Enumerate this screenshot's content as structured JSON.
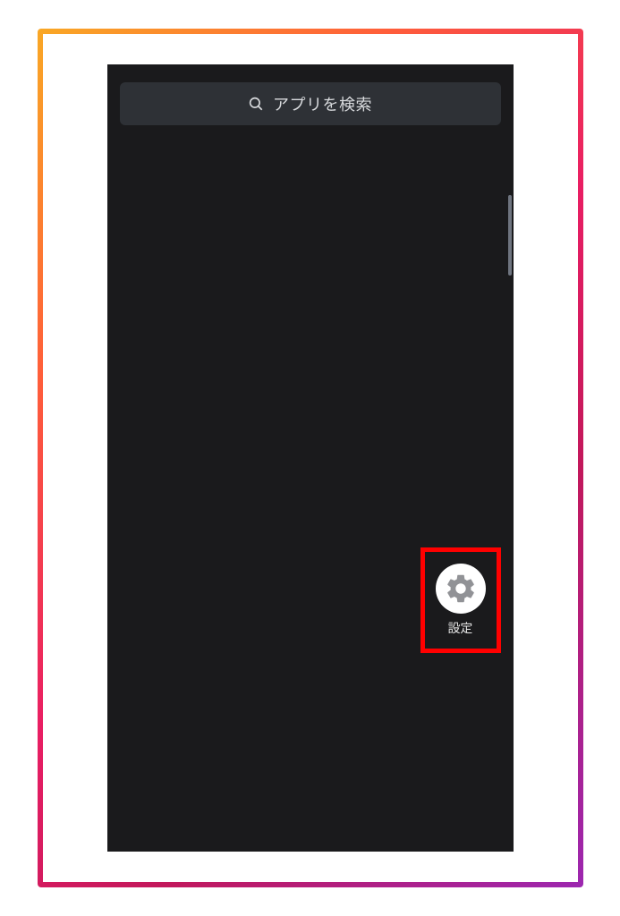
{
  "search": {
    "placeholder": "アプリを検索"
  },
  "apps": {
    "settings": {
      "label": "設定"
    }
  }
}
